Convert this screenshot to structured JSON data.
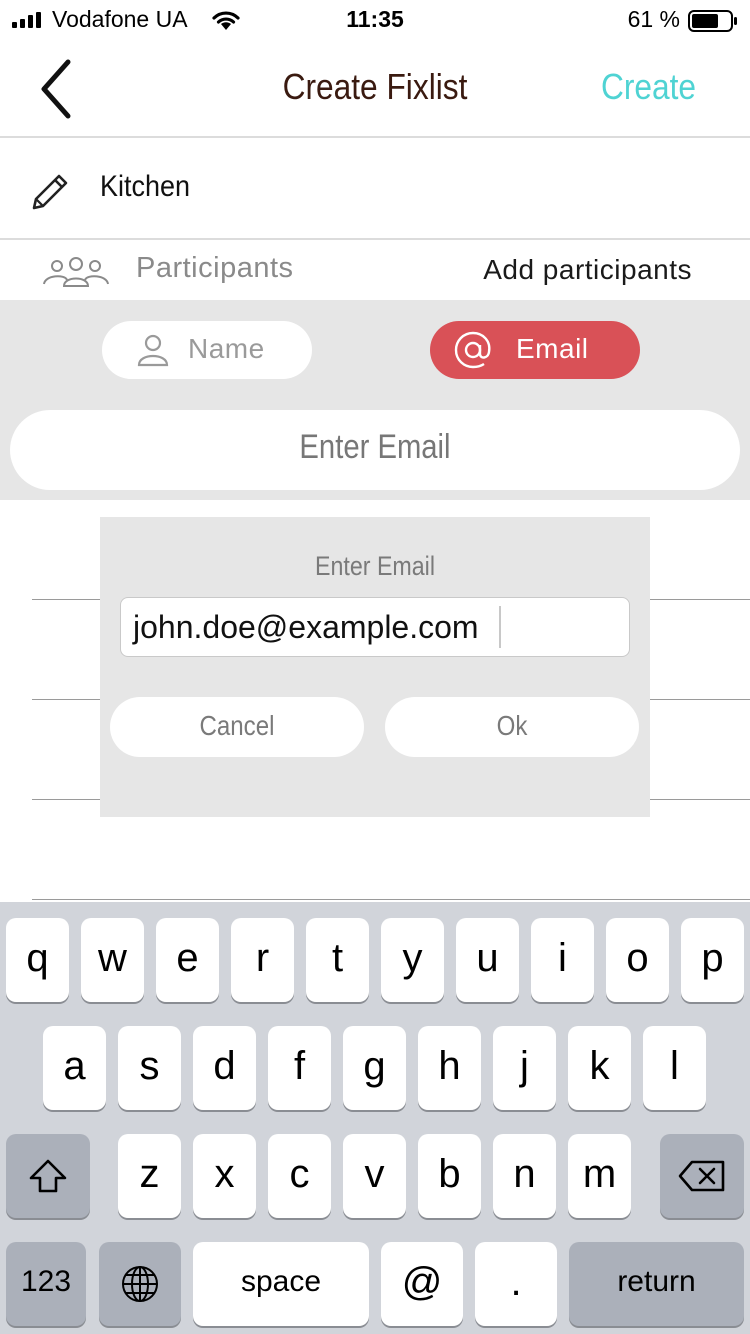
{
  "status_bar": {
    "carrier": "Vodafone UA",
    "time": "11:35",
    "battery_percent": "61 %"
  },
  "nav": {
    "title": "Create Fixlist",
    "create_label": "Create"
  },
  "fixlist": {
    "name": "Kitchen"
  },
  "participants": {
    "label": "Participants",
    "add_label": "Add participants"
  },
  "segment": {
    "name_label": "Name",
    "email_label": "Email",
    "selected": "Email"
  },
  "email_input": {
    "placeholder": "Enter Email"
  },
  "dialog": {
    "title": "Enter Email",
    "value": "john.doe@example.com",
    "cancel_label": "Cancel",
    "ok_label": "Ok"
  },
  "keyboard": {
    "row1": [
      "q",
      "w",
      "e",
      "r",
      "t",
      "y",
      "u",
      "i",
      "o",
      "p"
    ],
    "row2": [
      "a",
      "s",
      "d",
      "f",
      "g",
      "h",
      "j",
      "k",
      "l"
    ],
    "row3": [
      "z",
      "x",
      "c",
      "v",
      "b",
      "n",
      "m"
    ],
    "numbers_label": "123",
    "space_label": "space",
    "at_label": "@",
    "dot_label": ".",
    "return_label": "return"
  },
  "colors": {
    "accent": "#4fd3d3",
    "email_active": "#d95157",
    "title_color": "#3a1a10"
  }
}
